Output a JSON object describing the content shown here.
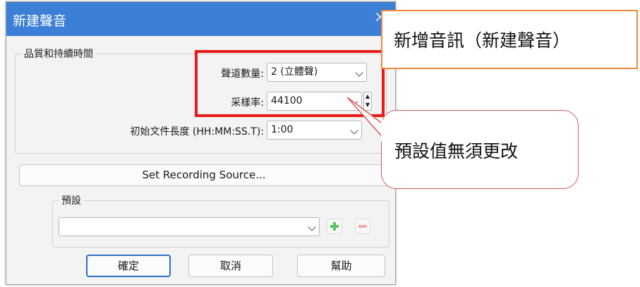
{
  "dialog": {
    "title": "新建聲音",
    "close_glyph": "×"
  },
  "quality_group": {
    "legend": "品質和持續時間",
    "channels_label": "聲道數量:",
    "channels_value": "2 (立體聲)",
    "samplerate_label": "采樣率:",
    "samplerate_value": "44100",
    "length_label": "初始文件長度 (HH:MM:SS.T):",
    "length_value": "1:00"
  },
  "recording_source_button": "Set Recording Source...",
  "preset_group": {
    "legend": "預設",
    "value": ""
  },
  "buttons": {
    "ok": "確定",
    "cancel": "取消",
    "help": "幫助"
  },
  "annotations": {
    "title_callout": "新增音訊（新建聲音）",
    "default_callout": "預設值無須更改"
  },
  "colors": {
    "titlebar": "#3b7fd6",
    "highlight_box": "#e81a1a",
    "callout_orange": "#f0883a",
    "add_icon": "#5ec25e",
    "remove_icon": "#f0a8a8"
  },
  "icons": [
    "close-icon",
    "chevron-down-icon",
    "spin-up-icon",
    "spin-down-icon",
    "plus-icon",
    "minus-icon"
  ]
}
